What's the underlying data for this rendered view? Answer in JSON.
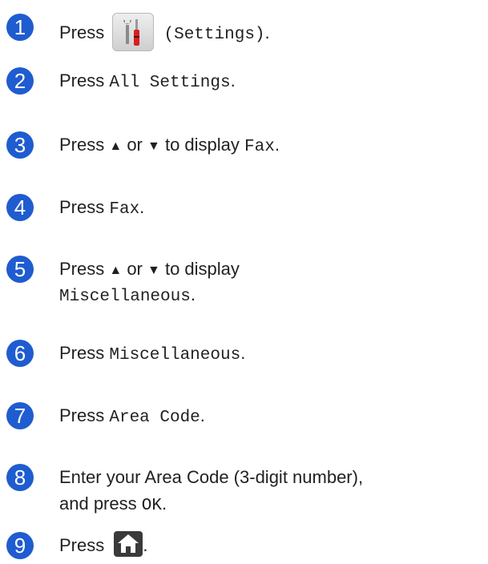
{
  "steps": [
    {
      "num": "1",
      "t1": "Press",
      "t2": "(Settings)",
      "t3": "."
    },
    {
      "num": "2",
      "t1": "Press ",
      "t2": "All Settings",
      "t3": "."
    },
    {
      "num": "3",
      "t1": "Press ",
      "up": "▲",
      "t2": " or ",
      "down": "▼",
      "t3": " to display ",
      "t4": "Fax",
      "t5": "."
    },
    {
      "num": "4",
      "t1": "Press ",
      "t2": "Fax",
      "t3": "."
    },
    {
      "num": "5",
      "t1": "Press ",
      "up": "▲",
      "t2": " or ",
      "down": "▼",
      "t3": " to display",
      "line2": "Miscellaneous",
      "line2_end": "."
    },
    {
      "num": "6",
      "t1": "Press ",
      "t2": "Miscellaneous",
      "t3": "."
    },
    {
      "num": "7",
      "t1": "Press ",
      "t2": "Area Code",
      "t3": "."
    },
    {
      "num": "8",
      "t1": "Enter your Area Code (3-digit number),",
      "line2a": "and press ",
      "line2b": "OK",
      "line2c": "."
    },
    {
      "num": "9",
      "t1": "Press",
      "t3": "."
    }
  ],
  "icons": {
    "settings": "settings-icon",
    "home": "home-icon"
  },
  "colors": {
    "badge": "#1f5ccf",
    "text": "#231f20"
  }
}
